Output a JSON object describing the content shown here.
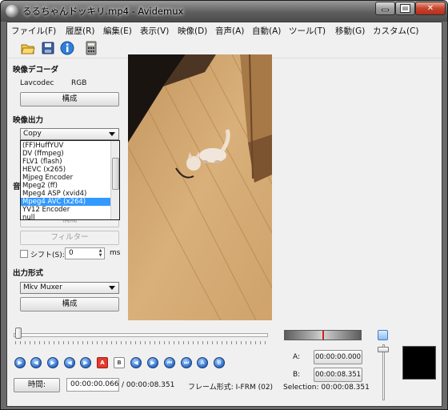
{
  "window": {
    "title": "るるちゃんドッキリ.mp4 - Avidemux"
  },
  "menu": [
    {
      "label": "ファイル(F)"
    },
    {
      "label": "履歴(R)"
    },
    {
      "label": "編集(E)"
    },
    {
      "label": "表示(V)"
    },
    {
      "label": "映像(D)"
    },
    {
      "label": "音声(A)"
    },
    {
      "label": "自動(A)"
    },
    {
      "label": "ツール(T)"
    },
    {
      "label": "移動(G)"
    },
    {
      "label": "カスタム(C)"
    }
  ],
  "toolbar": {
    "icons": [
      "open-folder-icon",
      "save-disk-icon",
      "info-icon",
      "calculator-icon"
    ]
  },
  "video_decoder": {
    "label": "映像デコーダ",
    "codec_name": "Lavcodec",
    "codec_format": "RGB",
    "config_button": "構成"
  },
  "video_output": {
    "label": "映像出力",
    "selected": "Copy",
    "dropdown_options": [
      "(FF)HuffYUV",
      "DV (ffmpeg)",
      "FLV1 (flash)",
      "HEVC (x265)",
      "Mjpeg Encoder",
      "Mpeg2 (ff)",
      "Mpeg4 ASP (xvid4)",
      "Mpeg4 AVC (x264)",
      "YV12 Encoder",
      "null"
    ],
    "highlighted_option": "Mpeg4 AVC (x264)"
  },
  "audio_output": {
    "label_partial": "音",
    "config_button": "構成",
    "filter_button": "フィルター",
    "shift_label": "シフト(S):",
    "shift_value": "0",
    "shift_unit": "ms"
  },
  "output_format": {
    "label": "出力形式",
    "selected": "Mkv Muxer",
    "config_button": "構成"
  },
  "playback": {
    "time_button": "時間:",
    "current_time": "00:00:00.066",
    "total_time": "/ 00:00:08.351",
    "frame_type": "フレーム形式: I-FRM (02)",
    "icons": [
      "play-icon",
      "rewind-icon",
      "fast-forward-icon",
      "prev-frame-icon",
      "next-frame-icon",
      "set-marker-a-icon",
      "set-marker-b-icon",
      "prev-black-icon",
      "next-black-icon",
      "first-frame-icon",
      "last-frame-icon",
      "goto-marker-a-icon",
      "goto-marker-b-icon"
    ],
    "marker_a_label": "A:",
    "marker_a_value": "00:00:00.000",
    "marker_b_label": "B:",
    "marker_b_value": "00:00:08.351",
    "selection": "Selection: 00:00:08.351"
  },
  "colors": {
    "highlight": "#3399ff",
    "record_red": "#e33b2e",
    "titlebar": "#5e5e5e"
  }
}
